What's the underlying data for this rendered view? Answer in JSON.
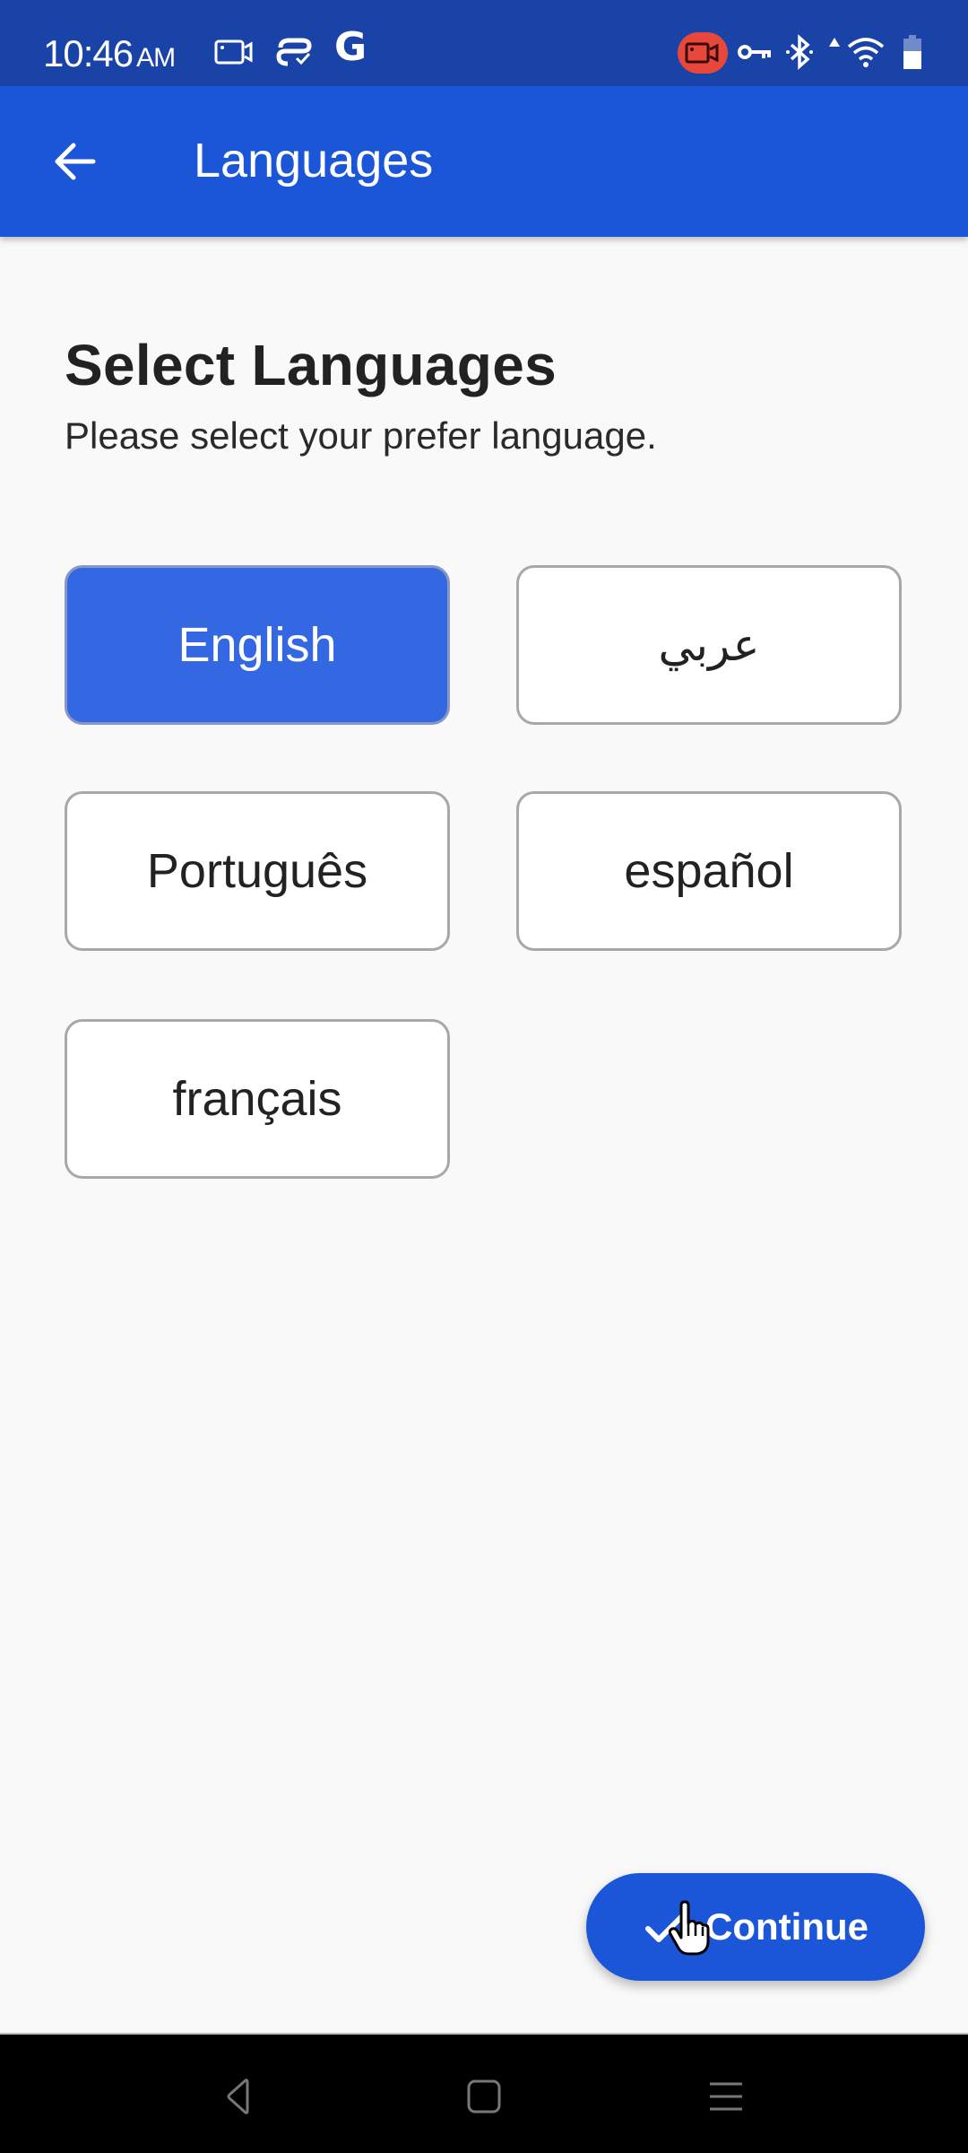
{
  "status_bar": {
    "time": "10:46",
    "ampm": "AM",
    "left_icons": [
      "screen-record-icon",
      "sync-check-icon",
      "google-icon"
    ],
    "google_glyph": "G",
    "right_icons": [
      "recording-icon",
      "vpn-key-icon",
      "bluetooth-icon",
      "signal-icon",
      "wifi-icon",
      "battery-icon"
    ]
  },
  "app_bar": {
    "title": "Languages",
    "back_icon": "arrow-back-icon",
    "background": "#1c56d8"
  },
  "main": {
    "heading": "Select Languages",
    "subheading": "Please select your prefer language.",
    "languages": [
      {
        "label": "English",
        "selected": true
      },
      {
        "label": "عربي",
        "selected": false
      },
      {
        "label": "Português",
        "selected": false
      },
      {
        "label": "español",
        "selected": false
      },
      {
        "label": "français",
        "selected": false
      }
    ],
    "selected_color": "#3468e2"
  },
  "continue_button": {
    "label": "Continue",
    "icon": "check-icon"
  },
  "nav_bar": {
    "buttons": [
      "back",
      "home",
      "recents"
    ]
  }
}
